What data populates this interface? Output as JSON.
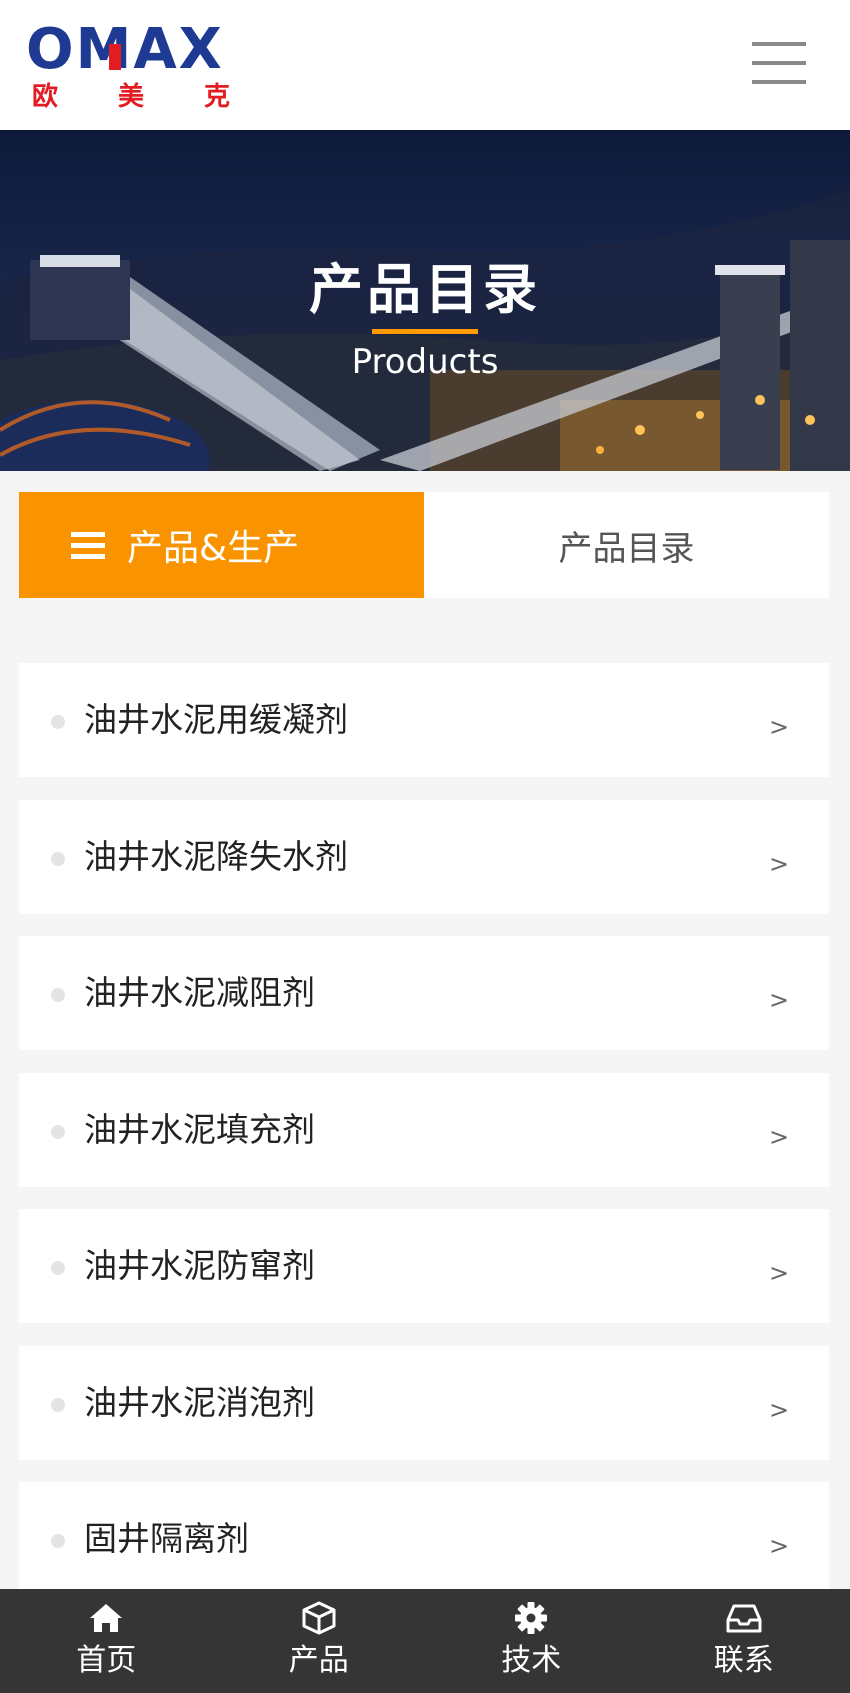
{
  "header": {
    "logo_text": "OMAX",
    "logo_cn": [
      "欧",
      "美",
      "克"
    ],
    "menu_icon": "hamburger-icon"
  },
  "banner": {
    "title": "产品目录",
    "subtitle": "Products"
  },
  "tabs": {
    "active": {
      "icon": "list-icon",
      "label": "产品&生产"
    },
    "inactive": {
      "label": "产品目录"
    }
  },
  "products": [
    {
      "name": "油井水泥用缓凝剂",
      "arrow": ">"
    },
    {
      "name": "油井水泥降失水剂",
      "arrow": ">"
    },
    {
      "name": "油井水泥减阻剂",
      "arrow": ">"
    },
    {
      "name": "油井水泥填充剂",
      "arrow": ">"
    },
    {
      "name": "油井水泥防窜剂",
      "arrow": ">"
    },
    {
      "name": "油井水泥消泡剂",
      "arrow": ">"
    },
    {
      "name": "固井隔离剂",
      "arrow": ">"
    }
  ],
  "bottom_nav": [
    {
      "icon": "home-icon",
      "label": "首页"
    },
    {
      "icon": "box-icon",
      "label": "产品"
    },
    {
      "icon": "gear-icon",
      "label": "技术"
    },
    {
      "icon": "inbox-icon",
      "label": "联系"
    }
  ],
  "colors": {
    "accent": "#fa9300",
    "logo_blue": "#1f3a93",
    "logo_red": "#e31b23",
    "nav_bg": "#353535"
  }
}
